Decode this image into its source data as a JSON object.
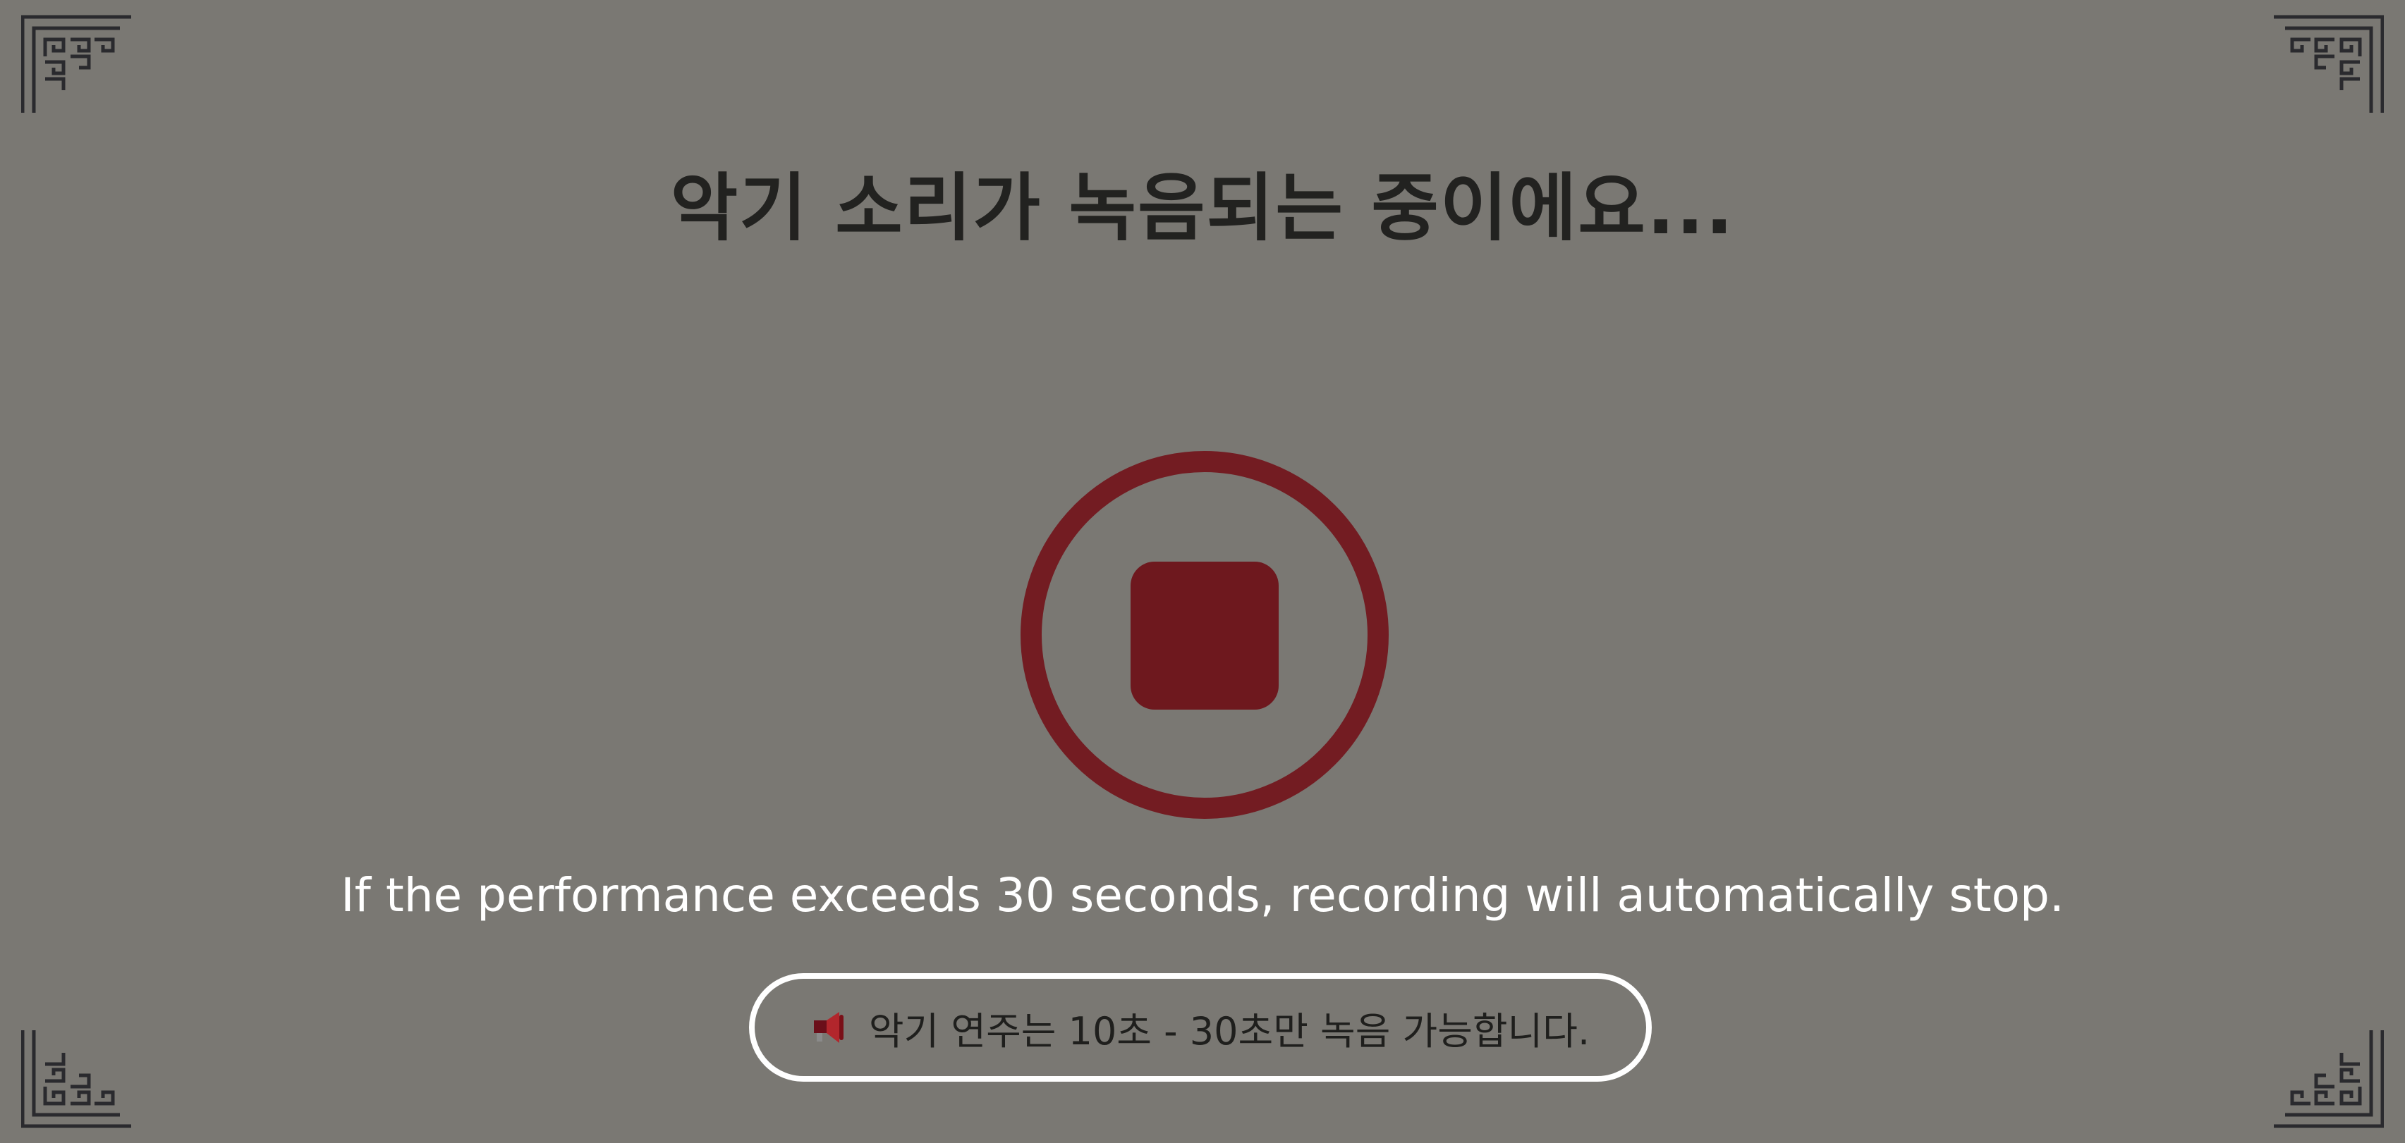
{
  "title": "악기 소리가 녹음되는 중이에요...",
  "info_text": "If the performance exceeds 30 seconds, recording will automatically stop.",
  "notice": {
    "icon": "megaphone-icon",
    "text": "악기 연주는 10초 - 30초만 녹음 가능합니다."
  },
  "stop_button": {
    "icon": "stop-icon"
  },
  "colors": {
    "background": "#7a7873",
    "accent": "#731c22",
    "title": "#222220",
    "info_text": "#ffffff"
  }
}
